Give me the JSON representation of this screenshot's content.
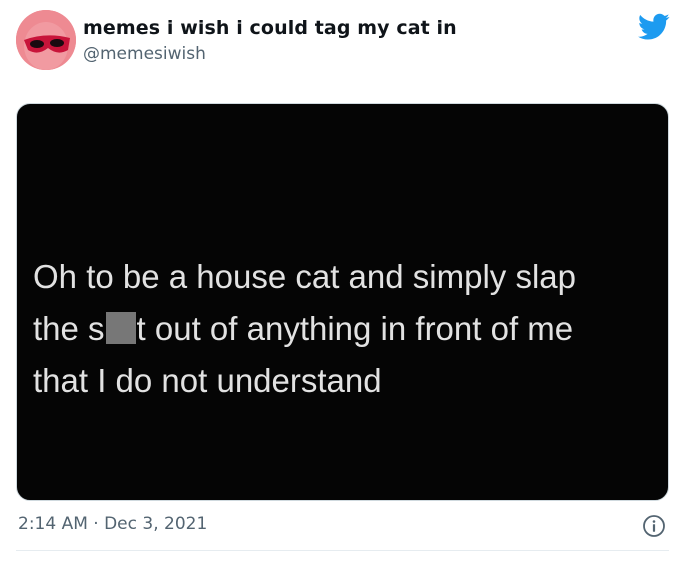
{
  "tweet": {
    "author": {
      "display_name": "memes i wish i could tag my cat in",
      "handle": "@memesiwish"
    },
    "media": {
      "lines": [
        {
          "before": "Oh to be a house cat and simply slap",
          "after": ""
        },
        {
          "before": "the s",
          "after": "t out of anything in front of me"
        },
        {
          "before": "that I do not understand",
          "after": ""
        }
      ]
    },
    "timestamp": "2:14 AM · Dec 3, 2021"
  },
  "colors": {
    "twitter_blue": "#1d9bf0",
    "avatar_bg": "#ee8a92",
    "media_bg": "#050505",
    "censor": "#777777"
  }
}
